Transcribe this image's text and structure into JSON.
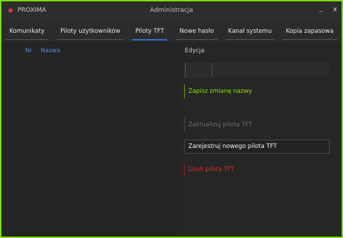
{
  "app": {
    "name": "PROXIMA",
    "window_title": "Administracja",
    "minimize_glyph": "_",
    "close_glyph": "x"
  },
  "colors": {
    "frame_border": "#7fe000",
    "accent_blue": "#2f6fd6",
    "save_green": "#8ee000",
    "delete_red": "#e12a2a",
    "logo_red": "#e0323c"
  },
  "tabs": [
    {
      "label": "Komunikaty"
    },
    {
      "label": "Piloty użytkowników"
    },
    {
      "label": "Piloty TFT",
      "active": true
    },
    {
      "label": "Nowe hasło"
    },
    {
      "label": "Kanał systemu"
    },
    {
      "label": "Kopia zapasowa"
    }
  ],
  "list": {
    "columns": [
      "Nr",
      "Nazwa"
    ],
    "rows": []
  },
  "edit": {
    "heading": "Edycja",
    "nr_value": "",
    "name_value": "",
    "save_label": "Zapisz zmianę nazwy",
    "update_label": "Zaktualizuj pilota TFT",
    "register_label": "Zarejestruj nowego pilota TFT",
    "delete_label": "Usuń pilota TFT"
  }
}
